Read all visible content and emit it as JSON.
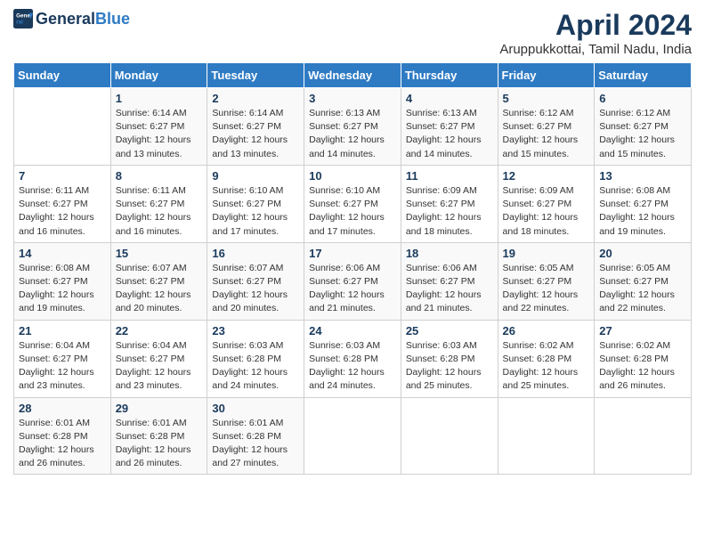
{
  "header": {
    "logo_general": "General",
    "logo_blue": "Blue",
    "title": "April 2024",
    "subtitle": "Aruppukkottai, Tamil Nadu, India"
  },
  "days_of_week": [
    "Sunday",
    "Monday",
    "Tuesday",
    "Wednesday",
    "Thursday",
    "Friday",
    "Saturday"
  ],
  "weeks": [
    [
      {
        "num": "",
        "info": ""
      },
      {
        "num": "1",
        "info": "Sunrise: 6:14 AM\nSunset: 6:27 PM\nDaylight: 12 hours\nand 13 minutes."
      },
      {
        "num": "2",
        "info": "Sunrise: 6:14 AM\nSunset: 6:27 PM\nDaylight: 12 hours\nand 13 minutes."
      },
      {
        "num": "3",
        "info": "Sunrise: 6:13 AM\nSunset: 6:27 PM\nDaylight: 12 hours\nand 14 minutes."
      },
      {
        "num": "4",
        "info": "Sunrise: 6:13 AM\nSunset: 6:27 PM\nDaylight: 12 hours\nand 14 minutes."
      },
      {
        "num": "5",
        "info": "Sunrise: 6:12 AM\nSunset: 6:27 PM\nDaylight: 12 hours\nand 15 minutes."
      },
      {
        "num": "6",
        "info": "Sunrise: 6:12 AM\nSunset: 6:27 PM\nDaylight: 12 hours\nand 15 minutes."
      }
    ],
    [
      {
        "num": "7",
        "info": "Sunrise: 6:11 AM\nSunset: 6:27 PM\nDaylight: 12 hours\nand 16 minutes."
      },
      {
        "num": "8",
        "info": "Sunrise: 6:11 AM\nSunset: 6:27 PM\nDaylight: 12 hours\nand 16 minutes."
      },
      {
        "num": "9",
        "info": "Sunrise: 6:10 AM\nSunset: 6:27 PM\nDaylight: 12 hours\nand 17 minutes."
      },
      {
        "num": "10",
        "info": "Sunrise: 6:10 AM\nSunset: 6:27 PM\nDaylight: 12 hours\nand 17 minutes."
      },
      {
        "num": "11",
        "info": "Sunrise: 6:09 AM\nSunset: 6:27 PM\nDaylight: 12 hours\nand 18 minutes."
      },
      {
        "num": "12",
        "info": "Sunrise: 6:09 AM\nSunset: 6:27 PM\nDaylight: 12 hours\nand 18 minutes."
      },
      {
        "num": "13",
        "info": "Sunrise: 6:08 AM\nSunset: 6:27 PM\nDaylight: 12 hours\nand 19 minutes."
      }
    ],
    [
      {
        "num": "14",
        "info": "Sunrise: 6:08 AM\nSunset: 6:27 PM\nDaylight: 12 hours\nand 19 minutes."
      },
      {
        "num": "15",
        "info": "Sunrise: 6:07 AM\nSunset: 6:27 PM\nDaylight: 12 hours\nand 20 minutes."
      },
      {
        "num": "16",
        "info": "Sunrise: 6:07 AM\nSunset: 6:27 PM\nDaylight: 12 hours\nand 20 minutes."
      },
      {
        "num": "17",
        "info": "Sunrise: 6:06 AM\nSunset: 6:27 PM\nDaylight: 12 hours\nand 21 minutes."
      },
      {
        "num": "18",
        "info": "Sunrise: 6:06 AM\nSunset: 6:27 PM\nDaylight: 12 hours\nand 21 minutes."
      },
      {
        "num": "19",
        "info": "Sunrise: 6:05 AM\nSunset: 6:27 PM\nDaylight: 12 hours\nand 22 minutes."
      },
      {
        "num": "20",
        "info": "Sunrise: 6:05 AM\nSunset: 6:27 PM\nDaylight: 12 hours\nand 22 minutes."
      }
    ],
    [
      {
        "num": "21",
        "info": "Sunrise: 6:04 AM\nSunset: 6:27 PM\nDaylight: 12 hours\nand 23 minutes."
      },
      {
        "num": "22",
        "info": "Sunrise: 6:04 AM\nSunset: 6:27 PM\nDaylight: 12 hours\nand 23 minutes."
      },
      {
        "num": "23",
        "info": "Sunrise: 6:03 AM\nSunset: 6:28 PM\nDaylight: 12 hours\nand 24 minutes."
      },
      {
        "num": "24",
        "info": "Sunrise: 6:03 AM\nSunset: 6:28 PM\nDaylight: 12 hours\nand 24 minutes."
      },
      {
        "num": "25",
        "info": "Sunrise: 6:03 AM\nSunset: 6:28 PM\nDaylight: 12 hours\nand 25 minutes."
      },
      {
        "num": "26",
        "info": "Sunrise: 6:02 AM\nSunset: 6:28 PM\nDaylight: 12 hours\nand 25 minutes."
      },
      {
        "num": "27",
        "info": "Sunrise: 6:02 AM\nSunset: 6:28 PM\nDaylight: 12 hours\nand 26 minutes."
      }
    ],
    [
      {
        "num": "28",
        "info": "Sunrise: 6:01 AM\nSunset: 6:28 PM\nDaylight: 12 hours\nand 26 minutes."
      },
      {
        "num": "29",
        "info": "Sunrise: 6:01 AM\nSunset: 6:28 PM\nDaylight: 12 hours\nand 26 minutes."
      },
      {
        "num": "30",
        "info": "Sunrise: 6:01 AM\nSunset: 6:28 PM\nDaylight: 12 hours\nand 27 minutes."
      },
      {
        "num": "",
        "info": ""
      },
      {
        "num": "",
        "info": ""
      },
      {
        "num": "",
        "info": ""
      },
      {
        "num": "",
        "info": ""
      }
    ]
  ]
}
